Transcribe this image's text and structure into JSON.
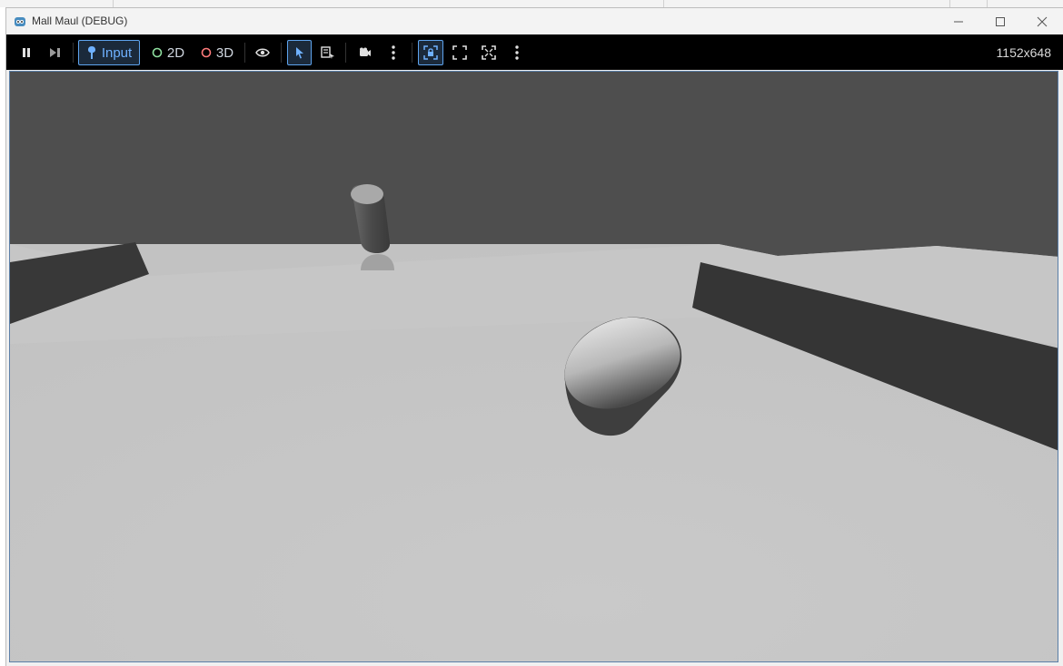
{
  "background_window": {
    "text": "..."
  },
  "window": {
    "title": "Mall Maul (DEBUG)",
    "app_icon": "godot-icon",
    "controls": {
      "minimize": "minimize-icon",
      "maximize": "maximize-icon",
      "close": "close-icon"
    }
  },
  "toolbar": {
    "input_label": "Input",
    "mode_2d_label": "2D",
    "mode_3d_label": "3D",
    "resolution": "1152x648",
    "colors": {
      "accent": "#5ea4ee",
      "mode_2d": "#8fe0a0",
      "mode_3d": "#ff7b7b"
    },
    "icons": [
      "pause-icon",
      "step-frame-icon",
      "input-icon",
      "visibility-icon",
      "select-arrow-icon",
      "list-select-icon",
      "camera-icon",
      "more-icon",
      "camera-lock-icon",
      "fullscreen-icon",
      "expand-icon",
      "more-icon"
    ]
  }
}
